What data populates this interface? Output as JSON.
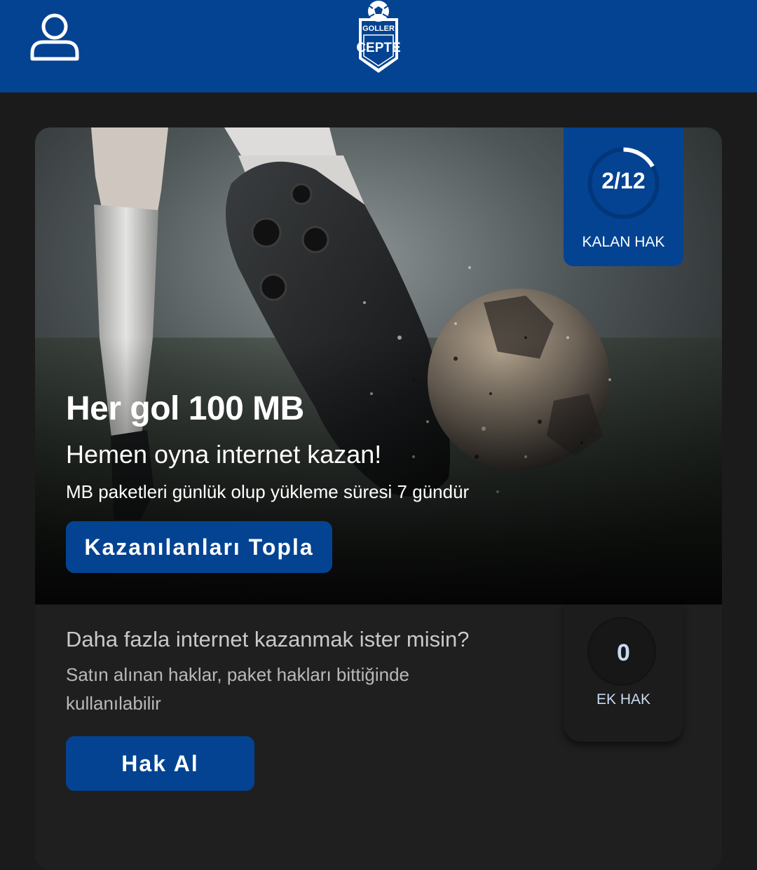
{
  "header": {
    "profile_icon": "user-icon",
    "logo": {
      "line1": "GOLLER",
      "line2": "CEPTE"
    },
    "background_color": "#034392"
  },
  "hero": {
    "title": "Her gol 100 MB",
    "subtitle": "Hemen oyna internet kazan!",
    "note": "MB paketleri günlük olup yükleme süresi 7 gündür",
    "collect_button_label": "Kazanılanları Topla"
  },
  "remaining": {
    "count_text": "2/12",
    "used": 2,
    "total": 12,
    "label": "KALAN HAK"
  },
  "extra": {
    "title": "Daha fazla internet kazanmak ister misin?",
    "description": "Satın alınan haklar, paket hakları bittiğinde kullanılabilir",
    "buy_button_label": "Hak Al",
    "count": "0",
    "label": "EK HAK"
  },
  "colors": {
    "accent": "#034392",
    "page_background": "#1b1b1b",
    "card_background": "#1f1f1f"
  }
}
